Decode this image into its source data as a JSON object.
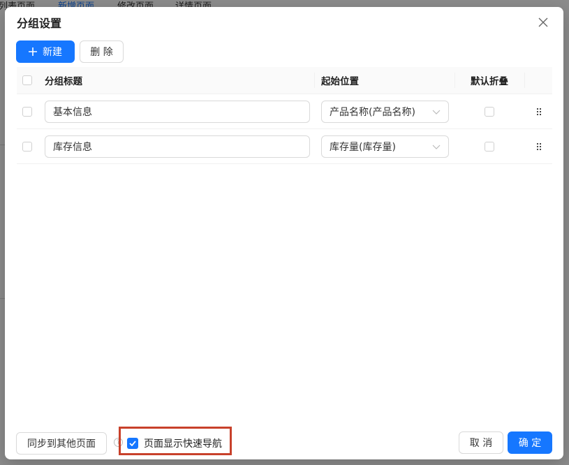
{
  "background": {
    "tabs": [
      "列表页面",
      "新增页面",
      "修改页面",
      "详情页面"
    ],
    "active_tab": "新增页面"
  },
  "modal": {
    "title": "分组设置",
    "toolbar": {
      "new_label": "新建",
      "delete_label": "删 除"
    },
    "table": {
      "headers": {
        "title": "分组标题",
        "start": "起始位置",
        "collapse": "默认折叠"
      },
      "rows": [
        {
          "title": "基本信息",
          "start": "产品名称(产品名称)",
          "collapsed": false
        },
        {
          "title": "库存信息",
          "start": "库存量(库存量)",
          "collapsed": false
        }
      ]
    },
    "footer": {
      "sync_label": "同步到其他页面",
      "help_symbol": "?",
      "quick_nav_label": "页面显示快速导航",
      "quick_nav_checked": true,
      "cancel_label": "取 消",
      "ok_label": "确 定"
    }
  },
  "colors": {
    "primary": "#1677ff",
    "highlight": "#c8412b"
  }
}
